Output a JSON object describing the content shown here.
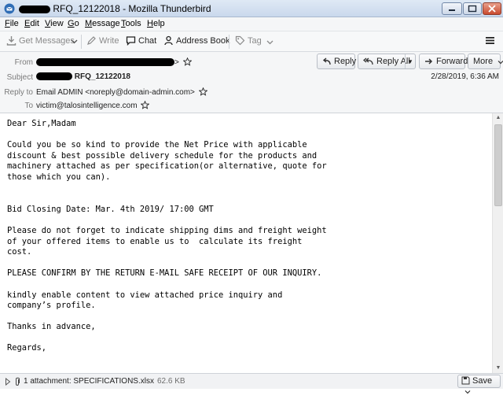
{
  "window": {
    "title_suffix": "RFQ_12122018 - Mozilla Thunderbird"
  },
  "menu": [
    {
      "key": "F",
      "rest": "ile"
    },
    {
      "key": "E",
      "rest": "dit"
    },
    {
      "key": "V",
      "rest": "iew"
    },
    {
      "key": "G",
      "rest": "o"
    },
    {
      "key": "M",
      "rest": "essage"
    },
    {
      "key": "T",
      "rest": "ools"
    },
    {
      "key": "H",
      "rest": "elp"
    }
  ],
  "toolbar": {
    "get_messages": "Get Messages",
    "write": "Write",
    "chat": "Chat",
    "address_book": "Address Book",
    "tag": "Tag"
  },
  "header": {
    "from_label": "From",
    "from_suffix": ">",
    "subject_label": "Subject",
    "subject_value": "RFQ_12122018",
    "reply_to_label": "Reply to",
    "reply_to_value": "Email ADMIN <noreply@domain-admin.com>",
    "to_label": "To",
    "to_value": "victim@talosintelligence.com",
    "date": "2/28/2019, 6:36 AM"
  },
  "actions": {
    "reply": "Reply",
    "reply_all": "Reply All",
    "forward": "Forward",
    "more": "More"
  },
  "body": {
    "text": "Dear Sir,Madam\n\nCould you be so kind to provide the Net Price with applicable\ndiscount & best possible delivery schedule for the products and\nmachinery attached as per specification(or alternative, quote for\nthose which you can).\n\n\nBid Closing Date: Mar. 4th 2019/ 17:00 GMT\n\nPlease do not forget to indicate shipping dims and freight weight\nof your offered items to enable us to  calculate its freight\ncost.\n\nPLEASE CONFIRM BY THE RETURN E-MAIL SAFE RECEIPT OF OUR INQUIRY.\n\nkindly enable content to view attached price inquiry and\ncompany’s profile.\n\nThanks in advance,\n\nRegards,"
  },
  "attachment": {
    "label": "1 attachment: SPECIFICATIONS.xlsx",
    "size": "62.6 KB",
    "save": "Save"
  },
  "colors": {
    "titlebar": "#c9d8ec",
    "toolbar": "#f7f8f9",
    "header": "#f5f6f7",
    "redaction": "#000000"
  }
}
